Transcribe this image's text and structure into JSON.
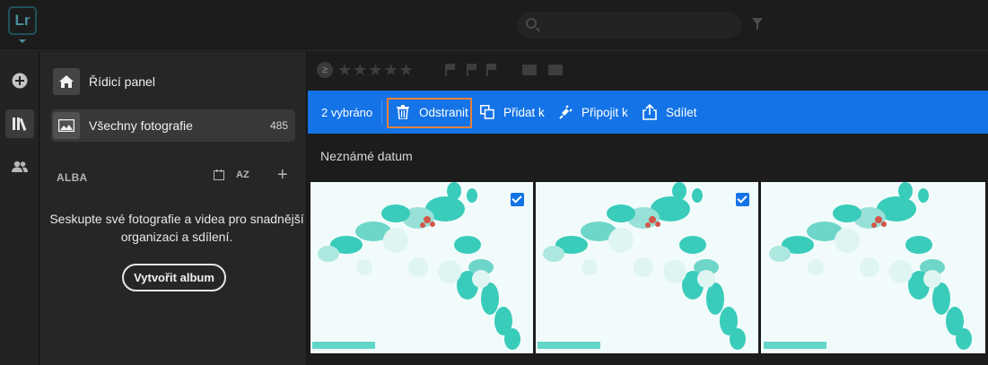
{
  "app": {
    "logo": "Lr"
  },
  "rail": {
    "items": [
      "add-icon",
      "library-icon",
      "people-icon"
    ]
  },
  "sidebar": {
    "items": [
      {
        "label": "Řídicí panel",
        "icon": "home-icon"
      },
      {
        "label": "Všechny fotografie",
        "count": "485",
        "icon": "photo-icon"
      }
    ],
    "albums_header": "ALBA",
    "sort_label": "AZ",
    "empty_text": "Seskupte své fotografie a videa pro snadnější organizaci a sdílení.",
    "create_album_label": "Vytvořit album"
  },
  "actionbar": {
    "selected": "2 vybráno",
    "delete_label": "Odstranit",
    "add_label": "Přidat k",
    "connect_label": "Připojit k",
    "share_label": "Sdílet"
  },
  "content": {
    "date_heading": "Neznámé datum",
    "thumbnails": [
      {
        "selected": true
      },
      {
        "selected": true
      },
      {
        "selected": false
      }
    ]
  },
  "colors": {
    "accent": "#1473e6",
    "highlight": "#e8813a",
    "flower": "#1fc4b0"
  }
}
